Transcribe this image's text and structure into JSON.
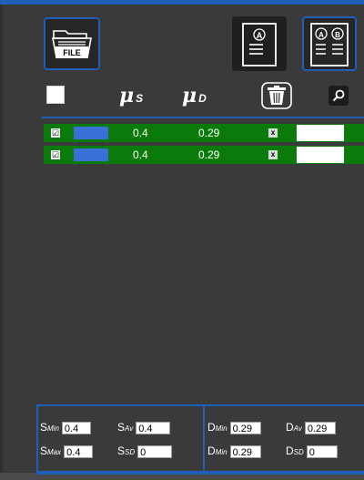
{
  "toolbar": {
    "file_button_icon": "file-folder-icon",
    "file_label": "FILE",
    "doc_a_icon": "document-a-icon",
    "doc_ab_icon": "document-ab-icon",
    "doc_a_letter": "A",
    "doc_b_letter": "B"
  },
  "headers": {
    "mu_symbol": "μ",
    "static_sub": "S",
    "dynamic_sub": "D",
    "delete_icon": "trash-icon",
    "zoom_icon": "magnifier-icon"
  },
  "rows": [
    {
      "checked": true,
      "checkbox_glyph": "☑",
      "color": "#3a6fd8",
      "mu_s": "0.4",
      "mu_d": "0.29",
      "delete_glyph": "x",
      "note": ""
    },
    {
      "checked": true,
      "checkbox_glyph": "☑",
      "color": "#3a6fd8",
      "mu_s": "0.4",
      "mu_d": "0.29",
      "delete_glyph": "x",
      "note": ""
    }
  ],
  "stats": {
    "s_letter": "S",
    "d_letter": "D",
    "s_min_label": "Min",
    "s_min": "0.4",
    "s_av_label": "Av",
    "s_av": "0.4",
    "s_max_label": "Max",
    "s_max": "0.4",
    "s_sd_label": "SD",
    "s_sd": "0",
    "d_min_label": "Min",
    "d_min": "0.29",
    "d_av_label": "Av",
    "d_av": "0.29",
    "d_min2_label": "Min",
    "d_min2": "0.29",
    "d_sd_label": "SD",
    "d_sd": "0"
  },
  "colors": {
    "accent": "#1e5fb8",
    "row_green": "#0a7a0a",
    "swatch_blue": "#3a6fd8",
    "background": "#3a3a3a"
  }
}
